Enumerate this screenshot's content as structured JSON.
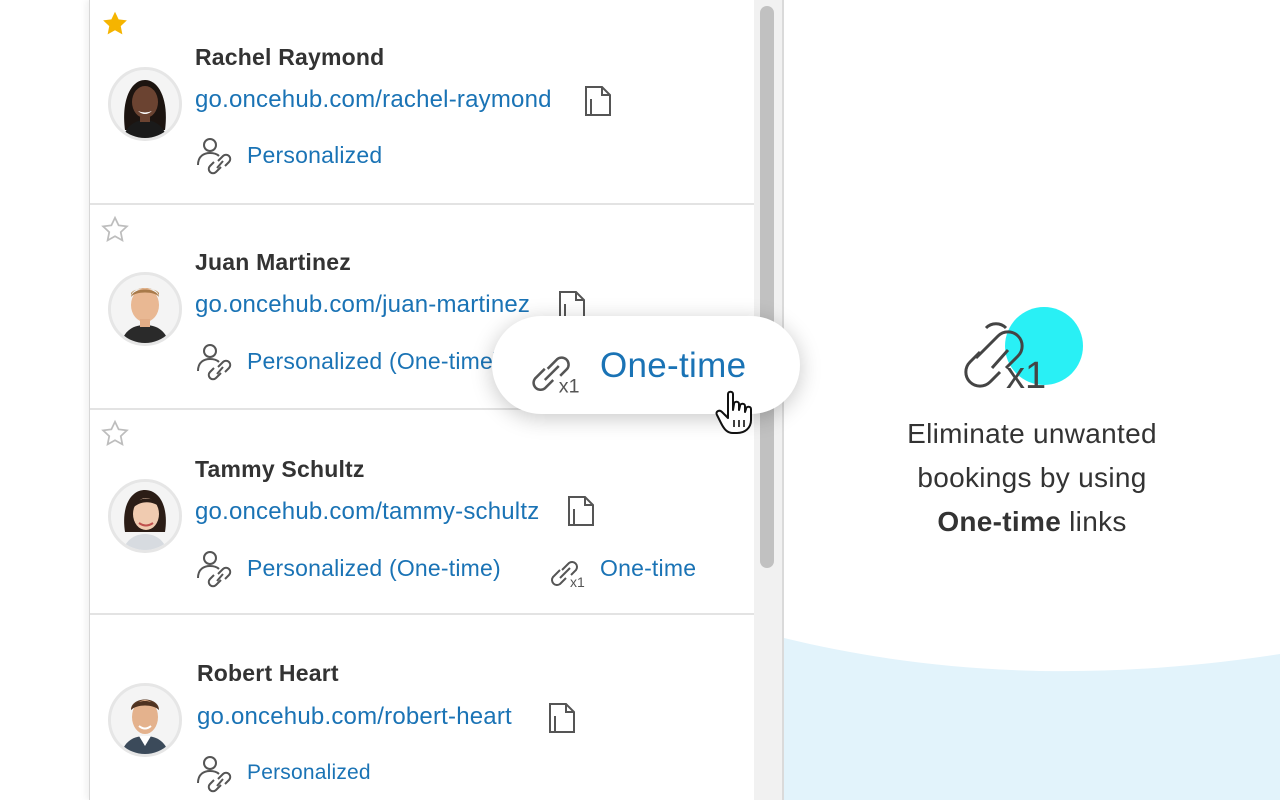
{
  "contacts": [
    {
      "name": "Rachel Raymond",
      "url": "go.oncehub.com/rachel-raymond",
      "starred": true,
      "link_label": "Personalized"
    },
    {
      "name": "Juan Martinez",
      "url": "go.oncehub.com/juan-martinez",
      "starred": false,
      "link_label": "Personalized (One-time)"
    },
    {
      "name": "Tammy Schultz",
      "url": "go.oncehub.com/tammy-schultz",
      "starred": false,
      "link_label": "Personalized (One-time)",
      "extra_link_label": "One-time"
    },
    {
      "name": "Robert Heart",
      "url": "go.oncehub.com/robert-heart",
      "starred": false,
      "link_label": "Personalized"
    }
  ],
  "tooltip": {
    "label": "One-time",
    "icon": "one-time-link-icon"
  },
  "promo": {
    "line1": "Eliminate unwanted",
    "line2": "bookings by using",
    "bold": "One-time",
    "line3_rest": " links"
  },
  "colors": {
    "link_blue": "#1a73b5",
    "star_gold": "#f5b400",
    "accent_cyan": "#29f0f5",
    "wave_blue": "#e2f3fb"
  },
  "icons": {
    "star_filled": "star-filled-icon",
    "star_outline": "star-outline-icon",
    "copy": "copy-document-icon",
    "personalized": "personalized-link-icon",
    "one_time": "one-time-link-icon",
    "cursor": "hand-pointer-cursor"
  }
}
